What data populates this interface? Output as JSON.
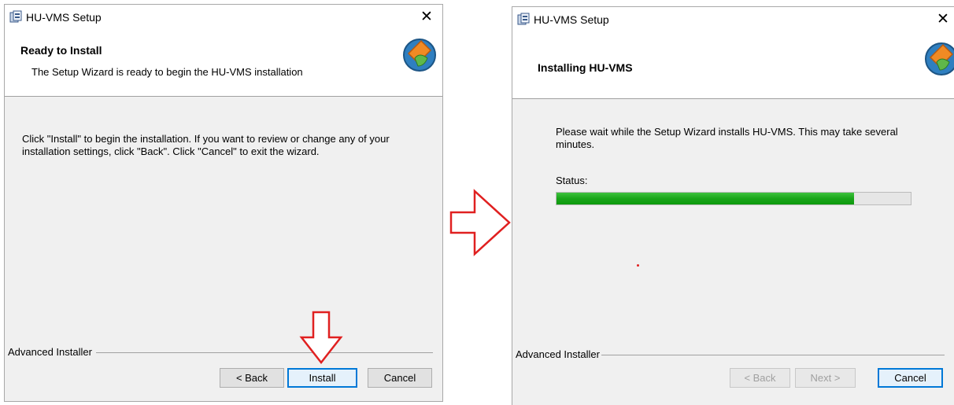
{
  "window1": {
    "title": "HU-VMS Setup",
    "close_glyph": "✕",
    "banner_title": "Ready to Install",
    "banner_subtitle": "The Setup Wizard is ready to begin the HU-VMS installation",
    "body_line1": "Click \"Install\" to begin the installation.  If you want to review or change any of your",
    "body_line2": "installation settings, click \"Back\".  Click \"Cancel\" to exit the wizard.",
    "footer_label": "Advanced Installer",
    "buttons": {
      "back": "< Back",
      "install": "Install",
      "cancel": "Cancel"
    }
  },
  "window2": {
    "title": "HU-VMS Setup",
    "close_glyph": "✕",
    "banner_title": "Installing HU-VMS",
    "body_line1": "Please wait while the Setup Wizard installs HU-VMS.  This may take several",
    "body_line2": "minutes.",
    "status_label": "Status:",
    "progress_fraction": 0.84,
    "footer_label": "Advanced Installer",
    "buttons": {
      "back": "< Back",
      "next": "Next >",
      "cancel": "Cancel"
    }
  },
  "colors": {
    "annotation_red": "#e02020",
    "progress_green": "#1aa51a",
    "primary_border": "#0078d7"
  },
  "icons": {
    "app_icon": "installer-icon",
    "banner_logo": "advanced-installer-logo",
    "annotation": "red-outline-arrow"
  }
}
